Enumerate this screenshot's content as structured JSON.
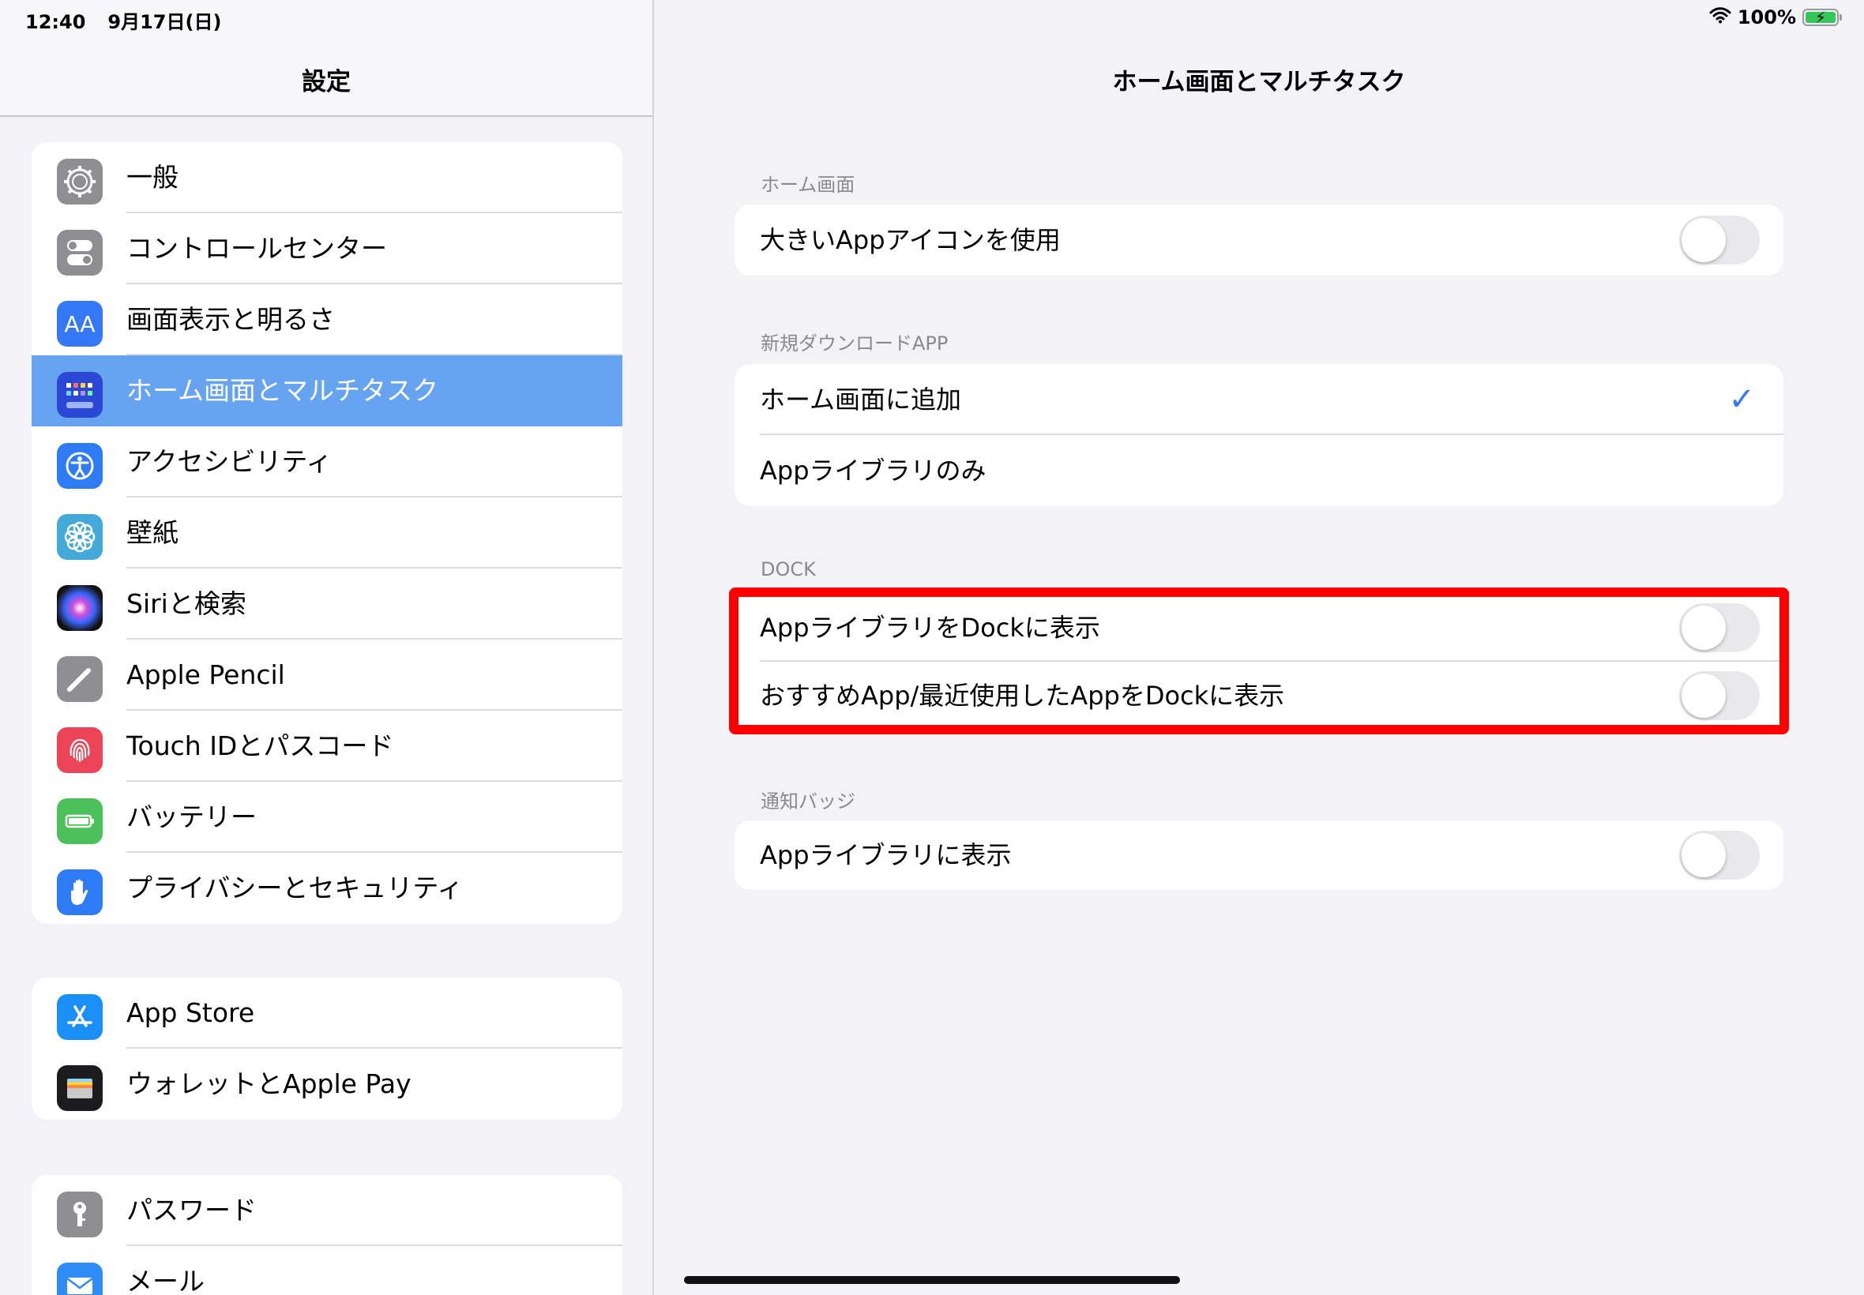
{
  "status_bar": {
    "time": "12:40",
    "date": "9月17日(日)",
    "battery_percent": "100%"
  },
  "sidebar": {
    "title": "設定",
    "groups": [
      [
        {
          "label": "一般",
          "icon": "gear-icon",
          "color": "#8e8e93"
        },
        {
          "label": "コントロールセンター",
          "icon": "control-center-icon",
          "color": "#8e8e93"
        },
        {
          "label": "画面表示と明るさ",
          "icon": "display-brightness-icon",
          "color": "#3478f6"
        },
        {
          "label": "ホーム画面とマルチタスク",
          "icon": "home-screen-icon",
          "color": "#2a47d6",
          "selected": true
        },
        {
          "label": "アクセシビリティ",
          "icon": "accessibility-icon",
          "color": "#2f7bf5"
        },
        {
          "label": "壁紙",
          "icon": "wallpaper-flower-icon",
          "color": "#43a9d8"
        },
        {
          "label": "Siriと検索",
          "icon": "siri-icon",
          "color": "#222222"
        },
        {
          "label": "Apple Pencil",
          "icon": "pencil-icon",
          "color": "#8e8e93"
        },
        {
          "label": "Touch IDとパスコード",
          "icon": "fingerprint-icon",
          "color": "#ec4456"
        },
        {
          "label": "バッテリー",
          "icon": "battery-icon",
          "color": "#4cc05b"
        },
        {
          "label": "プライバシーとセキュリティ",
          "icon": "hand-icon",
          "color": "#2f7bf5"
        }
      ],
      [
        {
          "label": "App Store",
          "icon": "app-store-icon",
          "color": "#1a8ff5"
        },
        {
          "label": "ウォレットとApple Pay",
          "icon": "wallet-icon",
          "color": "#1c1c1e"
        }
      ],
      [
        {
          "label": "パスワード",
          "icon": "key-icon",
          "color": "#8e8e93"
        },
        {
          "label": "メール",
          "icon": "mail-icon",
          "color": "#2f8bf5"
        }
      ]
    ]
  },
  "detail": {
    "title": "ホーム画面とマルチタスク",
    "sections": [
      {
        "header": "ホーム画面",
        "rows": [
          {
            "label": "大きいAppアイコンを使用",
            "control": "toggle",
            "on": false
          }
        ]
      },
      {
        "header": "新規ダウンロードAPP",
        "rows": [
          {
            "label": "ホーム画面に追加",
            "control": "check",
            "checked": true,
            "check_symbol": "✓"
          },
          {
            "label": "Appライブラリのみ",
            "control": "check",
            "checked": false
          }
        ]
      },
      {
        "header": "DOCK",
        "highlighted": true,
        "rows": [
          {
            "label": "AppライブラリをDockに表示",
            "control": "toggle",
            "on": false
          },
          {
            "label": "おすすめApp/最近使用したAppをDockに表示",
            "control": "toggle",
            "on": false
          }
        ]
      },
      {
        "header": "通知バッジ",
        "rows": [
          {
            "label": "Appライブラリに表示",
            "control": "toggle",
            "on": false
          }
        ]
      }
    ]
  },
  "colors": {
    "accent": "#3478f6",
    "selected_row": "#66a3f1",
    "highlight_box": "#ff0000",
    "background": "#f2f2f7"
  }
}
